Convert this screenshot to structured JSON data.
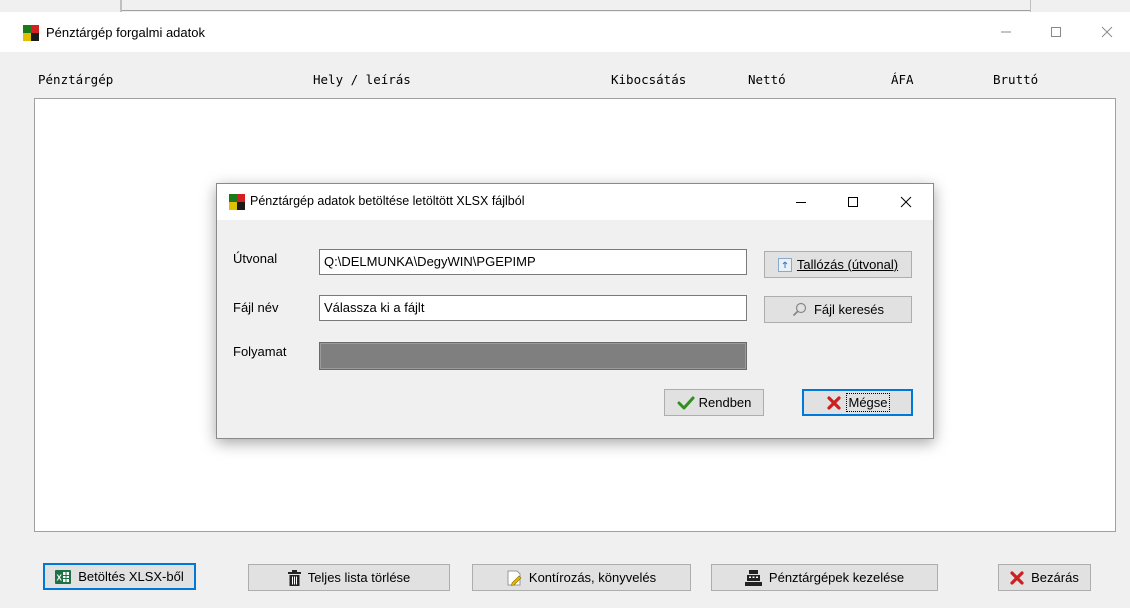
{
  "main": {
    "title": "Pénztárgép forgalmi adatok",
    "columns": [
      "Pénztárgép",
      "Hely / leírás",
      "Kibocsátás",
      "Nettó",
      "ÁFA",
      "Bruttó"
    ],
    "buttons": {
      "load": "Betöltés XLSX-ből",
      "clear": "Teljes lista törlése",
      "contiro": "Kontírozás, könyvelés",
      "manage": "Pénztárgépek kezelése",
      "close": "Bezárás"
    }
  },
  "dialog": {
    "title": "Pénztárgép adatok betöltése letöltött XLSX fájlból",
    "path_label": "Útvonal",
    "path_value": "Q:\\DELMUNKA\\DegyWIN\\PGEPIMP",
    "file_label": "Fájl név",
    "file_value": "Válassza ki a fájlt",
    "progress_label": "Folyamat",
    "progress_value": 0,
    "browse_button": "Tallózás (útvonal)",
    "find_button": "Fájl keresés",
    "ok_button": "Rendben",
    "cancel_button": "Mégse"
  },
  "colors": {
    "focus": "#0078d7",
    "progress": "#7f7f7f",
    "ok_check": "#2f8f1f",
    "cancel_x": "#cc1f1f"
  }
}
